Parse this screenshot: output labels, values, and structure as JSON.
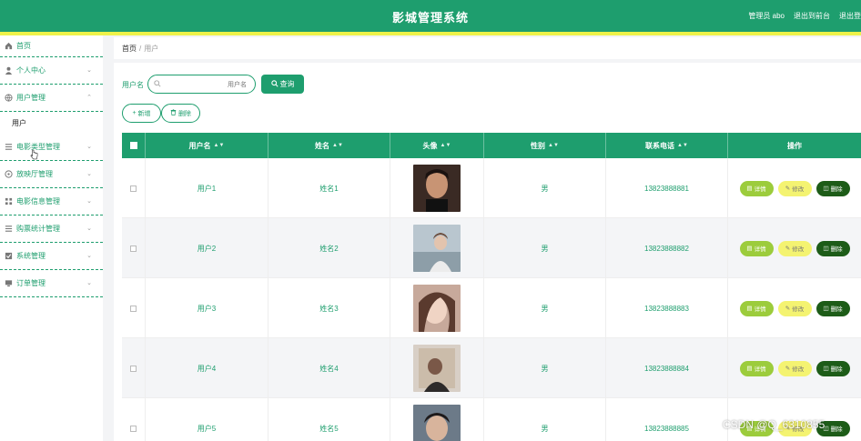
{
  "header": {
    "title": "影城管理系统",
    "admin_label": "管理员 abo",
    "back_label": "退出到前台",
    "logout_label": "退出登"
  },
  "sidebar": {
    "items": [
      {
        "label": "首页",
        "icon": "home-icon"
      },
      {
        "label": "个人中心",
        "icon": "user-icon"
      },
      {
        "label": "用户管理",
        "icon": "globe-icon",
        "expanded": true,
        "sub": [
          "用户"
        ]
      },
      {
        "label": "电影类型管理",
        "icon": "list-icon"
      },
      {
        "label": "放映厅管理",
        "icon": "circle-icon"
      },
      {
        "label": "电影信息管理",
        "icon": "grid-icon"
      },
      {
        "label": "购票统计管理",
        "icon": "list-icon"
      },
      {
        "label": "系统管理",
        "icon": "check-icon"
      },
      {
        "label": "订单管理",
        "icon": "monitor-icon"
      }
    ]
  },
  "breadcrumb": {
    "home": "首页",
    "sep": "/",
    "current": "用户"
  },
  "search": {
    "label": "用户名",
    "placeholder": "用户名",
    "button": "查询"
  },
  "actions": {
    "add": "新增",
    "delete": "删除"
  },
  "table": {
    "columns": [
      "用户名",
      "姓名",
      "头像",
      "性别",
      "联系电话",
      "操作"
    ],
    "row_actions": {
      "detail": "详情",
      "edit": "修改",
      "remove": "删除"
    },
    "rows": [
      {
        "username": "用户1",
        "name": "姓名1",
        "gender": "男",
        "phone": "13823888881"
      },
      {
        "username": "用户2",
        "name": "姓名2",
        "gender": "男",
        "phone": "13823888882"
      },
      {
        "username": "用户3",
        "name": "姓名3",
        "gender": "男",
        "phone": "13823888883"
      },
      {
        "username": "用户4",
        "name": "姓名4",
        "gender": "男",
        "phone": "13823888884"
      },
      {
        "username": "用户5",
        "name": "姓名5",
        "gender": "男",
        "phone": "13823888885"
      }
    ]
  },
  "colors": {
    "primary": "#1e9e6e",
    "strip": "#eef24a",
    "detail": "#9ccc3c",
    "edit": "#f4f371",
    "remove": "#1d5c18"
  },
  "watermark": "CSDN @Q_6310855"
}
